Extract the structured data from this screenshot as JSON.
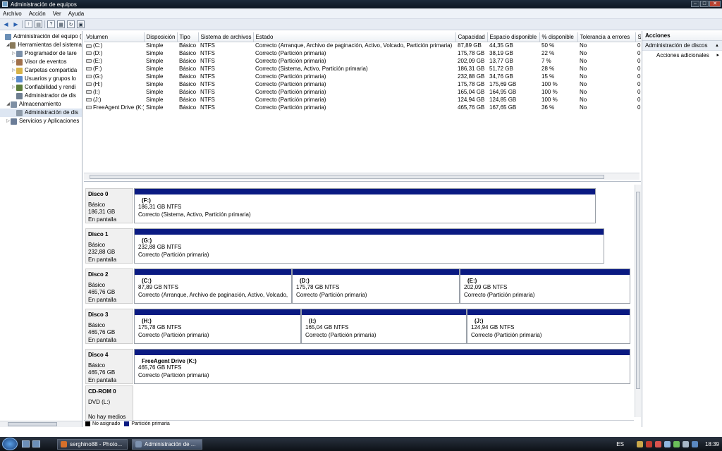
{
  "window": {
    "title": "Administración de equipos"
  },
  "menu": [
    "Archivo",
    "Acción",
    "Ver",
    "Ayuda"
  ],
  "tree": [
    {
      "label": "Administración del equipo (",
      "level": 0,
      "expander": "",
      "icon": "computer-icon",
      "color": "#6b8fb6"
    },
    {
      "label": "Herramientas del sistema",
      "level": 1,
      "expander": "◢",
      "icon": "tools-icon",
      "color": "#8a7a5a"
    },
    {
      "label": "Programador de tare",
      "level": 2,
      "expander": "▷",
      "icon": "clock-icon",
      "color": "#7a8fa8"
    },
    {
      "label": "Visor de eventos",
      "level": 2,
      "expander": "▷",
      "icon": "event-viewer-icon",
      "color": "#a0704a"
    },
    {
      "label": "Carpetas compartida",
      "level": 2,
      "expander": "▷",
      "icon": "folder-icon",
      "color": "#d7b34a"
    },
    {
      "label": "Usuarios y grupos lo",
      "level": 2,
      "expander": "▷",
      "icon": "users-icon",
      "color": "#5a8acb"
    },
    {
      "label": "Confiabilidad y rendi",
      "level": 2,
      "expander": "▷",
      "icon": "performance-icon",
      "color": "#5c7d3a"
    },
    {
      "label": "Administrador de dis",
      "level": 2,
      "expander": "",
      "icon": "device-manager-icon",
      "color": "#6f7f92"
    },
    {
      "label": "Almacenamiento",
      "level": 1,
      "expander": "◢",
      "icon": "storage-icon",
      "color": "#7d8fa4"
    },
    {
      "label": "Administración de dis",
      "level": 2,
      "expander": "",
      "icon": "disk-management-icon",
      "color": "#8d9aa8",
      "selected": true
    },
    {
      "label": "Servicios y Aplicaciones",
      "level": 1,
      "expander": "▷",
      "icon": "services-icon",
      "color": "#6b7d98"
    }
  ],
  "volumes": {
    "columns": [
      "Volumen",
      "Disposición",
      "Tipo",
      "Sistema de archivos",
      "Estado",
      "Capacidad",
      "Espacio disponible",
      "% disponible",
      "Tolerancia a errores",
      "S"
    ],
    "rows": [
      [
        "(C:)",
        "Simple",
        "Básico",
        "NTFS",
        "Correcto (Arranque, Archivo de paginación, Activo, Volcado, Partición primaria)",
        "87,89 GB",
        "44,35 GB",
        "50 %",
        "No",
        "0"
      ],
      [
        "(D:)",
        "Simple",
        "Básico",
        "NTFS",
        "Correcto (Partición primaria)",
        "175,78 GB",
        "38,19 GB",
        "22 %",
        "No",
        "0"
      ],
      [
        "(E:)",
        "Simple",
        "Básico",
        "NTFS",
        "Correcto (Partición primaria)",
        "202,09 GB",
        "13,77 GB",
        "7 %",
        "No",
        "0"
      ],
      [
        "(F:)",
        "Simple",
        "Básico",
        "NTFS",
        "Correcto (Sistema, Activo, Partición primaria)",
        "186,31 GB",
        "51,72 GB",
        "28 %",
        "No",
        "0"
      ],
      [
        "(G:)",
        "Simple",
        "Básico",
        "NTFS",
        "Correcto (Partición primaria)",
        "232,88 GB",
        "34,76 GB",
        "15 %",
        "No",
        "0"
      ],
      [
        "(H:)",
        "Simple",
        "Básico",
        "NTFS",
        "Correcto (Partición primaria)",
        "175,78 GB",
        "175,69 GB",
        "100 %",
        "No",
        "0"
      ],
      [
        "(I:)",
        "Simple",
        "Básico",
        "NTFS",
        "Correcto (Partición primaria)",
        "165,04 GB",
        "164,95 GB",
        "100 %",
        "No",
        "0"
      ],
      [
        "(J:)",
        "Simple",
        "Básico",
        "NTFS",
        "Correcto (Partición primaria)",
        "124,94 GB",
        "124,85 GB",
        "100 %",
        "No",
        "0"
      ],
      [
        "FreeAgent Drive (K:)",
        "Simple",
        "Básico",
        "NTFS",
        "Correcto (Partición primaria)",
        "465,76 GB",
        "167,65 GB",
        "36 %",
        "No",
        "0"
      ]
    ]
  },
  "disks": [
    {
      "name": "Disco 0",
      "type": "Básico",
      "size": "186,31 GB",
      "status": "En pantalla",
      "partitions": [
        {
          "label": "(F:)",
          "size": "186,31 GB NTFS",
          "state": "Correcto (Sistema, Activo, Partición primaria)"
        }
      ]
    },
    {
      "name": "Disco 1",
      "type": "Básico",
      "size": "232,88 GB",
      "status": "En pantalla",
      "partitions": [
        {
          "label": "(G:)",
          "size": "232,88 GB NTFS",
          "state": "Correcto (Partición primaria)"
        }
      ]
    },
    {
      "name": "Disco 2",
      "type": "Básico",
      "size": "465,76 GB",
      "status": "En pantalla",
      "partitions": [
        {
          "label": "(C:)",
          "size": "87,89 GB NTFS",
          "state": "Correcto (Arranque, Archivo de paginación, Activo, Volcado,"
        },
        {
          "label": "(D:)",
          "size": "175,78 GB NTFS",
          "state": "Correcto (Partición primaria)"
        },
        {
          "label": "(E:)",
          "size": "202,09 GB NTFS",
          "state": "Correcto (Partición primaria)"
        }
      ]
    },
    {
      "name": "Disco 3",
      "type": "Básico",
      "size": "465,76 GB",
      "status": "En pantalla",
      "partitions": [
        {
          "label": "(H:)",
          "size": "175,78 GB NTFS",
          "state": "Correcto (Partición primaria)"
        },
        {
          "label": "(I:)",
          "size": "165,04 GB NTFS",
          "state": "Correcto (Partición primaria)"
        },
        {
          "label": "(J:)",
          "size": "124,94 GB NTFS",
          "state": "Correcto (Partición primaria)"
        }
      ]
    },
    {
      "name": "Disco 4",
      "type": "Básico",
      "size": "465,76 GB",
      "status": "En pantalla",
      "partitions": [
        {
          "label": "FreeAgent Drive  (K:)",
          "size": "465,76 GB NTFS",
          "state": "Correcto (Partición primaria)"
        }
      ]
    }
  ],
  "cdrom": {
    "name": "CD-ROM 0",
    "type": "DVD (L:)",
    "status": "No hay medios"
  },
  "legend": {
    "unassigned": "No asignado",
    "primary": "Partición primaria",
    "unassigned_color": "#000000",
    "primary_color": "#0a1a82"
  },
  "actions": {
    "title": "Acciones",
    "section": "Administración de discos",
    "more": "Acciones adicionales"
  },
  "taskbar": {
    "tasks": [
      {
        "label": "serghino88 - Photo...",
        "icon_color": "#d8702a"
      },
      {
        "label": "Administración de ...",
        "icon_color": "#7d92b0"
      }
    ],
    "lang": "ES",
    "clock": "18:39"
  }
}
